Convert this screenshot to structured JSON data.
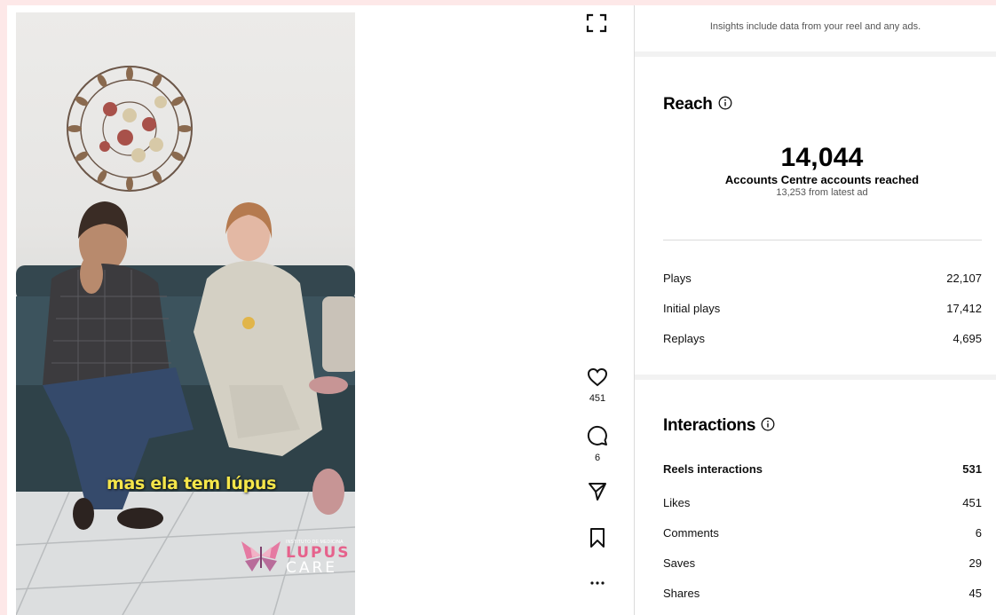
{
  "video": {
    "caption": "mas ela tem lúpus",
    "brand": {
      "small_text": "INSTITUTO DE MEDICINA",
      "line1": "LUPUS",
      "line2": "CARE"
    }
  },
  "actions": {
    "like_count": "451",
    "comment_count": "6"
  },
  "insights": {
    "notice": "Insights include data from your reel and any ads.",
    "reach": {
      "title": "Reach",
      "total": "14,044",
      "total_label": "Accounts Centre accounts reached",
      "total_sub": "13,253 from latest ad",
      "rows": [
        {
          "label": "Plays",
          "value": "22,107"
        },
        {
          "label": "Initial plays",
          "value": "17,412"
        },
        {
          "label": "Replays",
          "value": "4,695"
        }
      ]
    },
    "interactions": {
      "title": "Interactions",
      "rows": [
        {
          "label": "Reels interactions",
          "value": "531"
        },
        {
          "label": "Likes",
          "value": "451"
        },
        {
          "label": "Comments",
          "value": "6"
        },
        {
          "label": "Saves",
          "value": "29"
        },
        {
          "label": "Shares",
          "value": "45"
        }
      ]
    }
  },
  "icons": {
    "expand": "expand-icon",
    "like": "heart-icon",
    "comment": "comment-icon",
    "share": "send-icon",
    "save": "bookmark-icon",
    "more": "more-icon",
    "info": "info-icon"
  },
  "colors": {
    "page_background": "#fde8e8",
    "caption": "#f5e64a",
    "brand_pink": "#e6628c"
  }
}
